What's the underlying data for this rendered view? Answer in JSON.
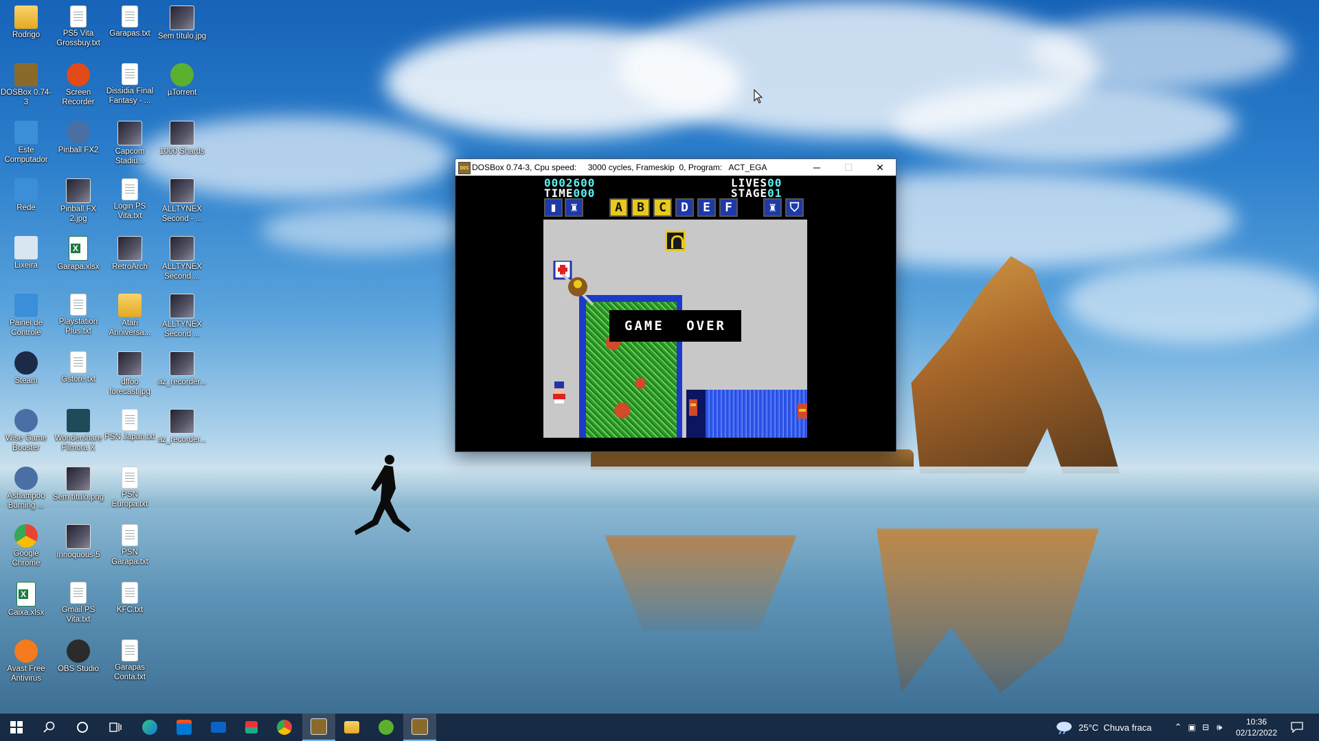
{
  "desktop": {
    "icons": [
      {
        "label": "Rodrigo",
        "icon": "user-folder-icon",
        "kind": "folder"
      },
      {
        "label": "PS5 Vita Grossbuy.txt",
        "icon": "text-file-icon",
        "kind": "file"
      },
      {
        "label": "Garapas.txt",
        "icon": "text-file-icon",
        "kind": "file"
      },
      {
        "label": "Sem título.jpg",
        "icon": "image-file-icon",
        "kind": "img"
      },
      {
        "label": "DOSBox 0.74-3",
        "icon": "dosbox-icon",
        "kind": "dos"
      },
      {
        "label": "Screen Recorder",
        "icon": "screen-recorder-icon",
        "kind": "rec"
      },
      {
        "label": "Dissidia Final Fantasy - ...",
        "icon": "text-file-icon",
        "kind": "file"
      },
      {
        "label": "µTorrent",
        "icon": "utorrent-icon",
        "kind": "utor"
      },
      {
        "label": "Este Computador",
        "icon": "computer-icon",
        "kind": "pc"
      },
      {
        "label": "Pinball FX2",
        "icon": "pinball-icon",
        "kind": "round"
      },
      {
        "label": "Capcom Stadiu...",
        "icon": "capcom-icon",
        "kind": "img"
      },
      {
        "label": "1000 Shards",
        "icon": "game-icon",
        "kind": "img"
      },
      {
        "label": "Rede",
        "icon": "network-icon",
        "kind": "net"
      },
      {
        "label": "Pinball FX 2.jpg",
        "icon": "image-file-icon",
        "kind": "img"
      },
      {
        "label": "Login PS Vita.txt",
        "icon": "text-file-icon",
        "kind": "file"
      },
      {
        "label": "ALLTYNEX Second - ...",
        "icon": "image-file-icon",
        "kind": "img"
      },
      {
        "label": "Lixeira",
        "icon": "recycle-bin-icon",
        "kind": "bin"
      },
      {
        "label": "Garapa.xlsx",
        "icon": "excel-file-icon",
        "kind": "xls"
      },
      {
        "label": "RetroArch",
        "icon": "retroarch-icon",
        "kind": "img"
      },
      {
        "label": "ALLTYNEX Second ...",
        "icon": "image-file-icon",
        "kind": "img"
      },
      {
        "label": "Painel de Controle",
        "icon": "control-panel-icon",
        "kind": "cp"
      },
      {
        "label": "Playstation Plus.txt",
        "icon": "text-file-icon",
        "kind": "file"
      },
      {
        "label": "Atari Anniversa...",
        "icon": "folder-icon",
        "kind": "folder"
      },
      {
        "label": "ALLTYNEX Second ...",
        "icon": "image-file-icon",
        "kind": "img"
      },
      {
        "label": "Steam",
        "icon": "steam-icon",
        "kind": "steam"
      },
      {
        "label": "Gstore.txt",
        "icon": "text-file-icon",
        "kind": "file"
      },
      {
        "label": "dffoo forecast.jpg",
        "icon": "image-file-icon",
        "kind": "img"
      },
      {
        "label": "az_recorder...",
        "icon": "image-file-icon",
        "kind": "img"
      },
      {
        "label": "Wise Game Booster",
        "icon": "game-booster-icon",
        "kind": "round"
      },
      {
        "label": "Wondershare Filmora X",
        "icon": "filmora-icon",
        "kind": "film"
      },
      {
        "label": "PSN Japan.txt",
        "icon": "text-file-icon",
        "kind": "file"
      },
      {
        "label": "az_recorder...",
        "icon": "image-file-icon",
        "kind": "img"
      },
      {
        "label": "Ashampoo Burning ...",
        "icon": "ashampoo-icon",
        "kind": "round"
      },
      {
        "label": "Sem título.png",
        "icon": "image-file-icon",
        "kind": "img"
      },
      {
        "label": "PSN Europa.txt",
        "icon": "text-file-icon",
        "kind": "file"
      },
      {
        "label": "",
        "icon": "",
        "kind": "none"
      },
      {
        "label": "Google Chrome",
        "icon": "chrome-icon",
        "kind": "chrome"
      },
      {
        "label": "Innoquous 5",
        "icon": "game-icon",
        "kind": "img"
      },
      {
        "label": "PSN Garapa.txt",
        "icon": "text-file-icon",
        "kind": "file"
      },
      {
        "label": "",
        "icon": "",
        "kind": "none"
      },
      {
        "label": "Caixa.xlsx",
        "icon": "excel-file-icon",
        "kind": "xls"
      },
      {
        "label": "Gmail PS Vita.txt",
        "icon": "text-file-icon",
        "kind": "file"
      },
      {
        "label": "KFC.txt",
        "icon": "text-file-icon",
        "kind": "file"
      },
      {
        "label": "",
        "icon": "",
        "kind": "none"
      },
      {
        "label": "Avast Free Antivirus",
        "icon": "avast-icon",
        "kind": "avast"
      },
      {
        "label": "OBS Studio",
        "icon": "obs-icon",
        "kind": "obs"
      },
      {
        "label": "Garapas Conta.txt",
        "icon": "text-file-icon",
        "kind": "file"
      }
    ]
  },
  "dosbox_window": {
    "title": "DOSBox 0.74-3, Cpu speed:     3000 cycles, Frameskip  0, Program:   ACT_EGA",
    "minimize": "─",
    "maximize": "☐",
    "close": "✕",
    "game": {
      "score": "0002600",
      "time_label": "TIME",
      "time_value": "000",
      "lives_label": "LIVES",
      "lives_value": "00",
      "stage_label": "STAGE",
      "stage_value": "01",
      "letters": [
        "A",
        "B",
        "C",
        "D",
        "E",
        "F"
      ],
      "message": "GAME OVER"
    }
  },
  "taskbar": {
    "apps": [
      {
        "name": "start-button",
        "icon": "windows-logo-icon"
      },
      {
        "name": "search-button",
        "icon": "search-icon"
      },
      {
        "name": "cortana-button",
        "icon": "cortana-icon"
      },
      {
        "name": "task-view-button",
        "icon": "task-view-icon"
      },
      {
        "name": "taskbar-edge",
        "icon": "edge-icon"
      },
      {
        "name": "taskbar-store",
        "icon": "store-icon"
      },
      {
        "name": "taskbar-mail",
        "icon": "mail-icon"
      },
      {
        "name": "taskbar-ftp",
        "icon": "ftp-icon"
      },
      {
        "name": "taskbar-chrome",
        "icon": "chrome-icon"
      },
      {
        "name": "taskbar-dosbox-pinned",
        "icon": "dosbox-icon"
      },
      {
        "name": "taskbar-explorer",
        "icon": "folder-icon"
      },
      {
        "name": "taskbar-utorrent",
        "icon": "utorrent-icon"
      },
      {
        "name": "taskbar-dosbox-active",
        "icon": "dosbox-icon"
      }
    ],
    "weather": "25°C  Chuva fraca",
    "time": "10:36",
    "date": "02/12/2022"
  }
}
